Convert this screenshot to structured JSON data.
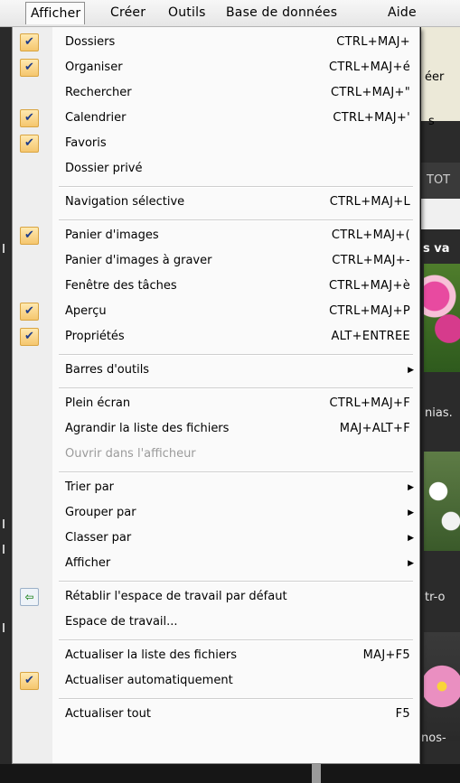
{
  "menubar": {
    "items": [
      "Afficher",
      "Créer",
      "Outils",
      "Base de données",
      "Aide"
    ]
  },
  "background_text": [
    "éer",
    "s",
    "TOT",
    "s va",
    "nias.",
    "tr-o",
    "nos-"
  ],
  "menu": {
    "items": [
      {
        "label": "Dossiers",
        "shortcut": "CTRL+MAJ+",
        "checked": true
      },
      {
        "label": "Organiser",
        "shortcut": "CTRL+MAJ+é",
        "checked": true
      },
      {
        "label": "Rechercher",
        "shortcut": "CTRL+MAJ+\"",
        "checked": false
      },
      {
        "label": "Calendrier",
        "shortcut": "CTRL+MAJ+'",
        "checked": true
      },
      {
        "label": "Favoris",
        "shortcut": "",
        "checked": true
      },
      {
        "label": "Dossier privé",
        "shortcut": "",
        "checked": false
      },
      {
        "label": "Navigation sélective",
        "shortcut": "CTRL+MAJ+L",
        "checked": false
      },
      {
        "label": "Panier d'images",
        "shortcut": "CTRL+MAJ+(",
        "checked": true
      },
      {
        "label": "Panier d'images à graver",
        "shortcut": "CTRL+MAJ+-",
        "checked": false
      },
      {
        "label": "Fenêtre des tâches",
        "shortcut": "CTRL+MAJ+è",
        "checked": false
      },
      {
        "label": "Aperçu",
        "shortcut": "CTRL+MAJ+P",
        "checked": true
      },
      {
        "label": "Propriétés",
        "shortcut": "ALT+ENTREE",
        "checked": true
      },
      {
        "label": "Barres d'outils",
        "shortcut": "",
        "checked": false,
        "submenu": true
      },
      {
        "label": "Plein écran",
        "shortcut": "CTRL+MAJ+F",
        "checked": false
      },
      {
        "label": "Agrandir la liste des fichiers",
        "shortcut": "MAJ+ALT+F",
        "checked": false
      },
      {
        "label": "Ouvrir dans l'afficheur",
        "shortcut": "",
        "checked": false,
        "disabled": true
      },
      {
        "label": "Trier par",
        "shortcut": "",
        "checked": false,
        "submenu": true
      },
      {
        "label": "Grouper par",
        "shortcut": "",
        "checked": false,
        "submenu": true
      },
      {
        "label": "Classer par",
        "shortcut": "",
        "checked": false,
        "submenu": true
      },
      {
        "label": "Afficher",
        "shortcut": "",
        "checked": false,
        "submenu": true
      },
      {
        "label": "Rétablir l'espace de travail par défaut",
        "shortcut": "",
        "checked": false,
        "icon": "workspace-reset-icon"
      },
      {
        "label": "Espace de travail...",
        "shortcut": "",
        "checked": false
      },
      {
        "label": "Actualiser la liste des fichiers",
        "shortcut": "MAJ+F5",
        "checked": false
      },
      {
        "label": "Actualiser automatiquement",
        "shortcut": "",
        "checked": true
      },
      {
        "label": "Actualiser tout",
        "shortcut": "F5",
        "checked": false
      }
    ]
  },
  "colors": {
    "check_bg": "#f5c66e",
    "menu_bg": "#fafafa",
    "gutter_bg": "#eeeeee",
    "disabled_text": "#9b9b9b"
  }
}
